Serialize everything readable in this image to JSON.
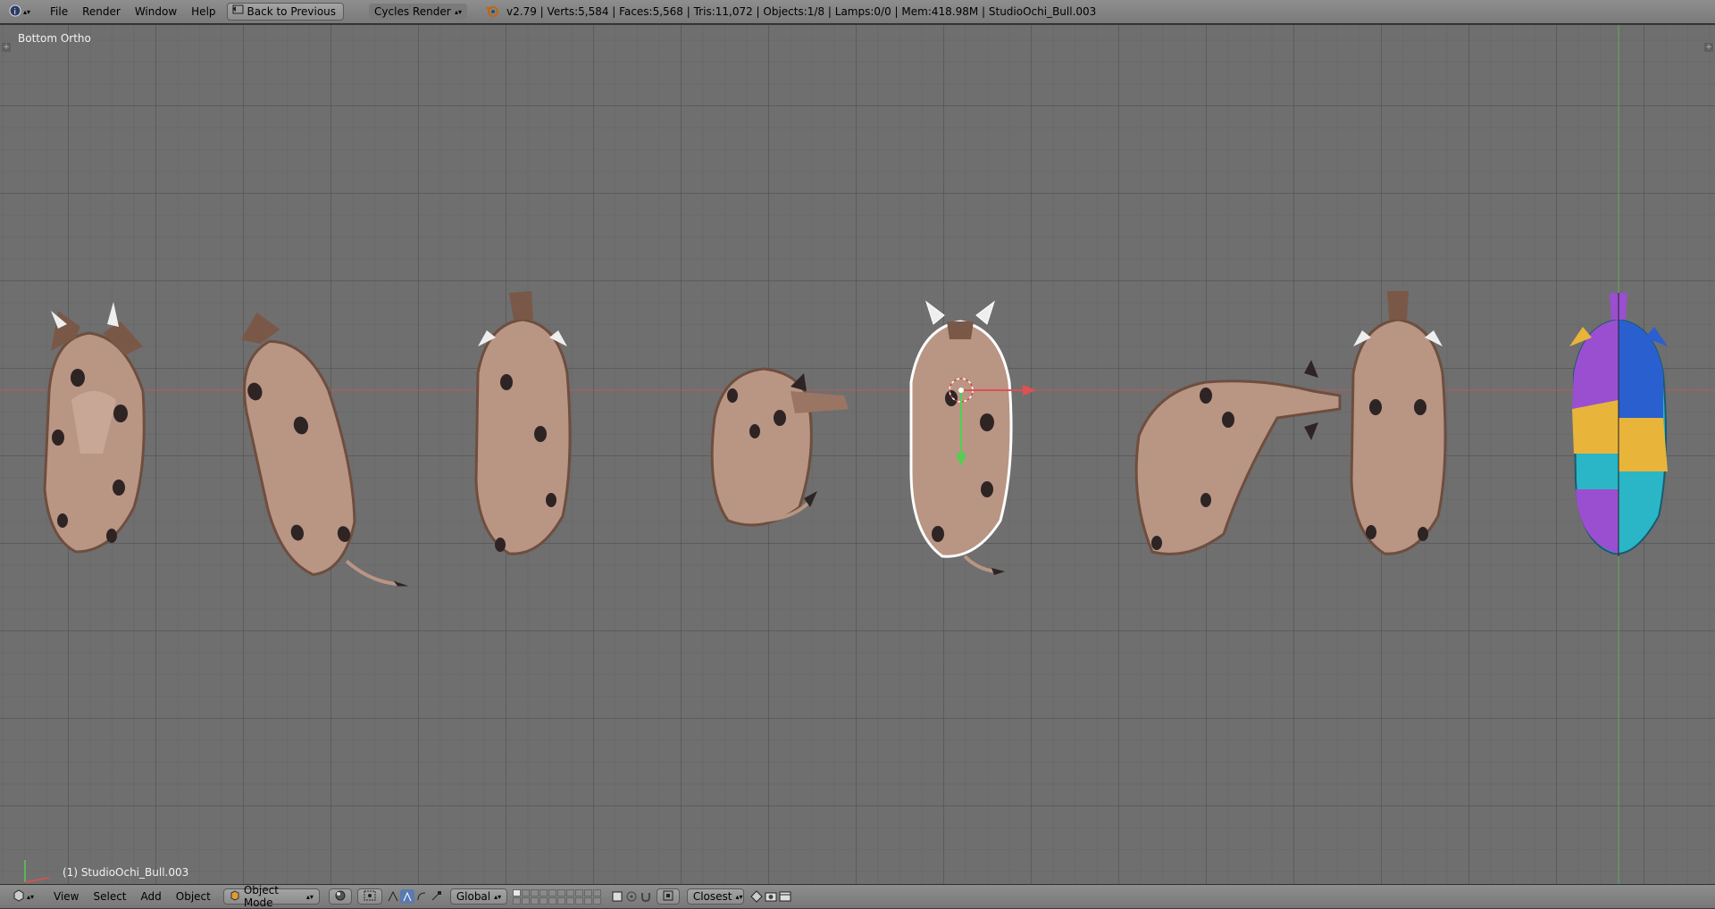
{
  "topbar": {
    "menus": [
      "File",
      "Render",
      "Window",
      "Help"
    ],
    "back_button": "Back to Previous",
    "render_engine": "Cycles Render",
    "stats": "v2.79 | Verts:5,584 | Faces:5,568 | Tris:11,072 | Objects:1/8 | Lamps:0/0 | Mem:418.98M | StudioOchi_Bull.003"
  },
  "viewport": {
    "view_name": "Bottom Ortho",
    "active_object": "(1) StudioOchi_Bull.003"
  },
  "bottombar": {
    "menus": [
      "View",
      "Select",
      "Add",
      "Object"
    ],
    "mode": "Object Mode",
    "orientation": "Global",
    "snap_target": "Closest"
  },
  "icons": {
    "editor_type": "info-icon",
    "engine_logo": "blender-logo-icon",
    "viewport_shading": "solid-shading-icon",
    "pivot": "pivot-point-icon",
    "manipulator": "manipulator-icon",
    "snap": "magnet-icon",
    "render": "render-icon"
  },
  "colors": {
    "header": "#8a8a8a",
    "viewport_bg": "#6f6f6f",
    "x_axis": "#e05050",
    "y_axis": "#50d050",
    "selection_outline": "#ffffff",
    "bull_skin": "#b99584",
    "bull_dark": "#7a5848"
  }
}
